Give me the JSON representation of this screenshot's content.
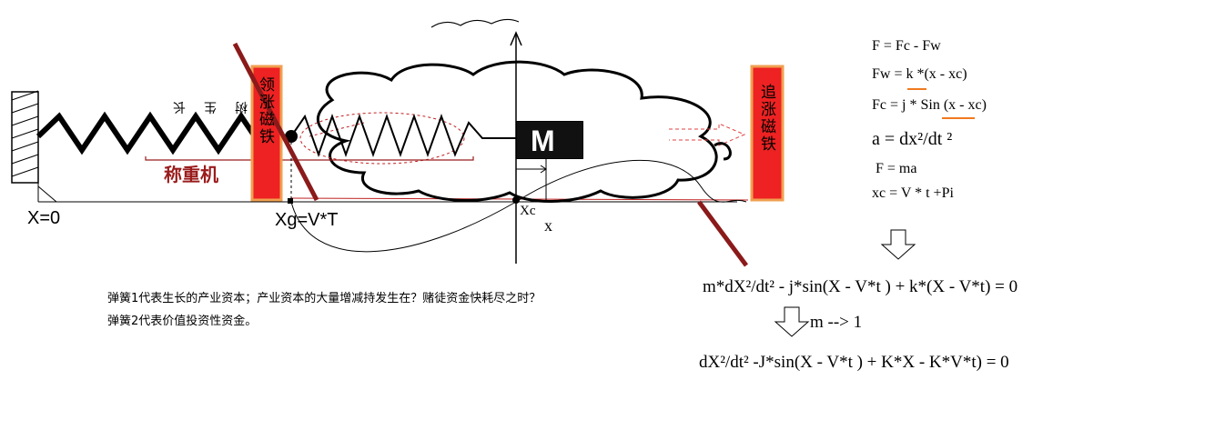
{
  "labels": {
    "x0": "X=0",
    "xg": "Xg=V*T",
    "xc": "Xc",
    "x": "x",
    "mass": "M",
    "scale": "称重机",
    "left_magnet": "领涨磁铁",
    "right_magnet": "追涨磁铁",
    "tree": "树生长"
  },
  "equations": [
    {
      "id": "eq1",
      "text": "F = Fc - Fw"
    },
    {
      "id": "eq2",
      "text": "Fw = k *(x - xc)"
    },
    {
      "id": "eq3",
      "text": "Fc = j * Sin (x - xc)"
    },
    {
      "id": "eq4",
      "text": "a = dx²/dt ²"
    },
    {
      "id": "eq5",
      "text": "F = ma"
    },
    {
      "id": "eq6",
      "text": "xc = V * t +Pi"
    }
  ],
  "derived": {
    "eq_full": "m*dX²/dt²  - j*sin(X - V*t ) +  k*(X - V*t) = 0",
    "limit": "m --> 1",
    "eq_reduced": "dX²/dt²  -J*sin(X - V*t ) + K*X - K*V*t) = 0"
  },
  "notes": {
    "line1": "弹簧1代表生长的产业资本；产业资本的大量增减持发生在？赌徒资金快耗尽之时？",
    "line2": "弹簧2代表价值投资性资金。"
  },
  "colors": {
    "magnet_fill": "#ee2222",
    "magnet_border": "#f0a050",
    "scale_text": "#9a1c1c",
    "slash": "#8b1a1a",
    "underline": "#f07a20",
    "mass_fill": "#111111"
  }
}
